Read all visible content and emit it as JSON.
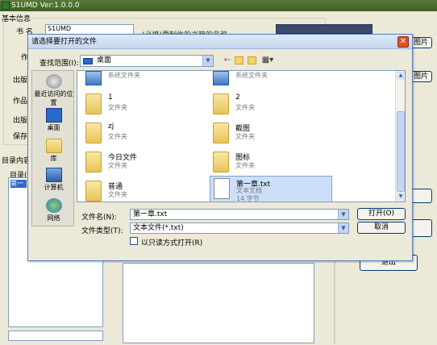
{
  "main_window": {
    "title": "S1UMD Ver:1.0.0.0",
    "basic_info_label": "基本信息",
    "book_name_label": "书 名",
    "book_name_value": "S1UMD",
    "author_label_partial": "作",
    "hint_text": "(必填)要制作的书籍的名称",
    "publish_label_partial": "出版",
    "works_label_partial": "作品",
    "publish2_label_partial": "出版",
    "save_label_partial": "保存",
    "toc_label_partial": "目录内容",
    "toc_sub_label": "目录(",
    "toc_first_item": "第一",
    "right_btn1": "图片",
    "right_btn2": "图片",
    "exit_btn": "退出"
  },
  "dialog": {
    "title": "请选择要打开的文件",
    "close_glyph": "✕",
    "look_in_label": "查找范围(I):",
    "look_in_value": "桌面",
    "places": [
      {
        "label": "最近访问的位置",
        "icon": "recent-places-icon"
      },
      {
        "label": "桌面",
        "icon": "desktop-icon"
      },
      {
        "label": "库",
        "icon": "library-icon"
      },
      {
        "label": "计算机",
        "icon": "computer-icon"
      },
      {
        "label": "网络",
        "icon": "network-icon"
      }
    ],
    "files": [
      {
        "name": "",
        "type": "系统文件夹",
        "icon": "system-folder-icon"
      },
      {
        "name": "",
        "type": "系统文件夹",
        "icon": "system-folder-icon"
      },
      {
        "name": "1",
        "type": "文件夹",
        "icon": "folder-icon"
      },
      {
        "name": "2",
        "type": "文件夹",
        "icon": "folder-icon"
      },
      {
        "name": "zj",
        "type": "文件夹",
        "icon": "folder-icon"
      },
      {
        "name": "截图",
        "type": "文件夹",
        "icon": "folder-icon"
      },
      {
        "name": "今日文件",
        "type": "文件夹",
        "icon": "folder-icon"
      },
      {
        "name": "图标",
        "type": "文件夹",
        "icon": "folder-icon"
      },
      {
        "name": "普通",
        "type": "文件夹",
        "icon": "folder-icon"
      },
      {
        "name": "第一章.txt",
        "type": "文本文档",
        "size": "14 字节",
        "icon": "text-file-icon"
      }
    ],
    "filename_label": "文件名(N):",
    "filename_value": "第一章.txt",
    "filetype_label": "文件类型(T):",
    "filetype_value": "文本文件(*.txt)",
    "readonly_label": "以只读方式打开(R)",
    "open_btn": "打开(O)",
    "cancel_btn": "取消"
  },
  "colors": {
    "selection": "#cde0fa",
    "folder": "#e8c458",
    "dialog_border": "#5a7fc0"
  }
}
